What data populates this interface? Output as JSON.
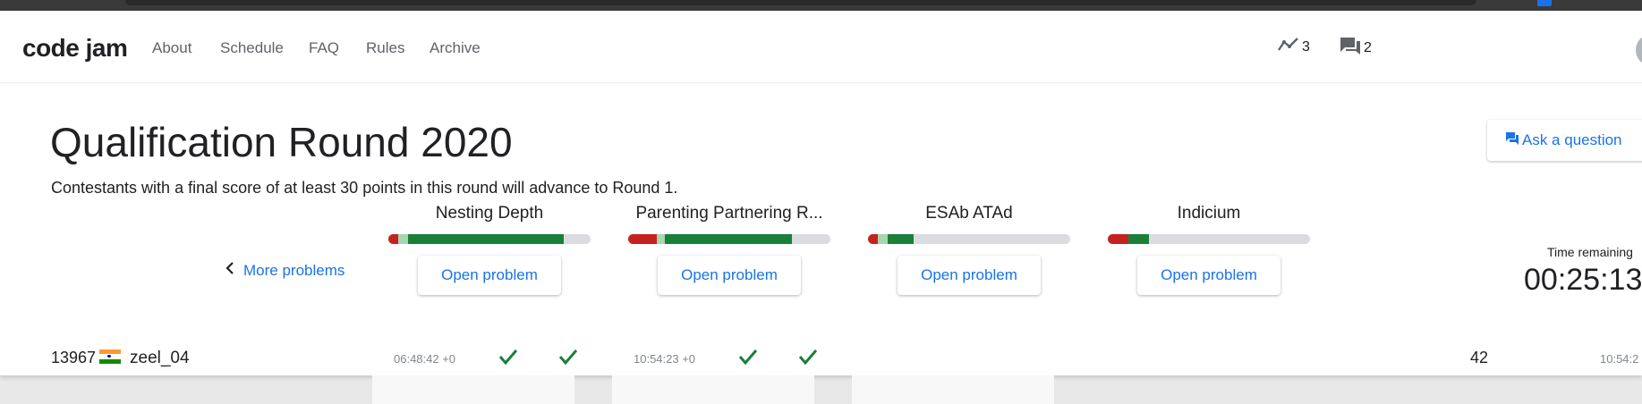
{
  "header": {
    "logo": "code jam",
    "nav": [
      "About",
      "Schedule",
      "FAQ",
      "Rules",
      "Archive"
    ],
    "stats_count": "3",
    "chat_count": "2"
  },
  "round": {
    "title": "Qualification Round 2020",
    "subtitle": "Contestants with a final score of at least 30 points in this round will advance to Round 1.",
    "ask_label": "Ask a question",
    "more_label": "More problems",
    "time_label": "Time remaining",
    "time_value": "00:25:13"
  },
  "problems": [
    {
      "name": "Nesting Depth",
      "button": "Open problem",
      "progress": {
        "red": 0.05,
        "light": 0.05,
        "green": 0.77
      }
    },
    {
      "name": "Parenting Partnering R...",
      "button": "Open problem",
      "progress": {
        "red": 0.14,
        "light": 0.04,
        "green": 0.63
      }
    },
    {
      "name": "ESAb ATAd",
      "button": "Open problem",
      "progress": {
        "red": 0.05,
        "light": 0.05,
        "green": 0.13
      }
    },
    {
      "name": "Indicium",
      "button": "Open problem",
      "progress": {
        "red": 0.1,
        "light": 0.0,
        "green": 0.1
      }
    }
  ],
  "scoreboard_row": {
    "rank": "13967",
    "username": "zeel_04",
    "p1_time": "06:48:42 +0",
    "p2_time": "10:54:23 +0",
    "score": "42",
    "last_time": "10:54:2"
  },
  "colors": {
    "accent": "#1a73e8",
    "red": "#c5221f",
    "green": "#188038",
    "light_green": "#a8d5b2",
    "track": "#dadce0"
  },
  "icons": [
    "stats-icon",
    "chat-icon",
    "chevron-left-icon",
    "check-icon",
    "india-flag-icon"
  ]
}
